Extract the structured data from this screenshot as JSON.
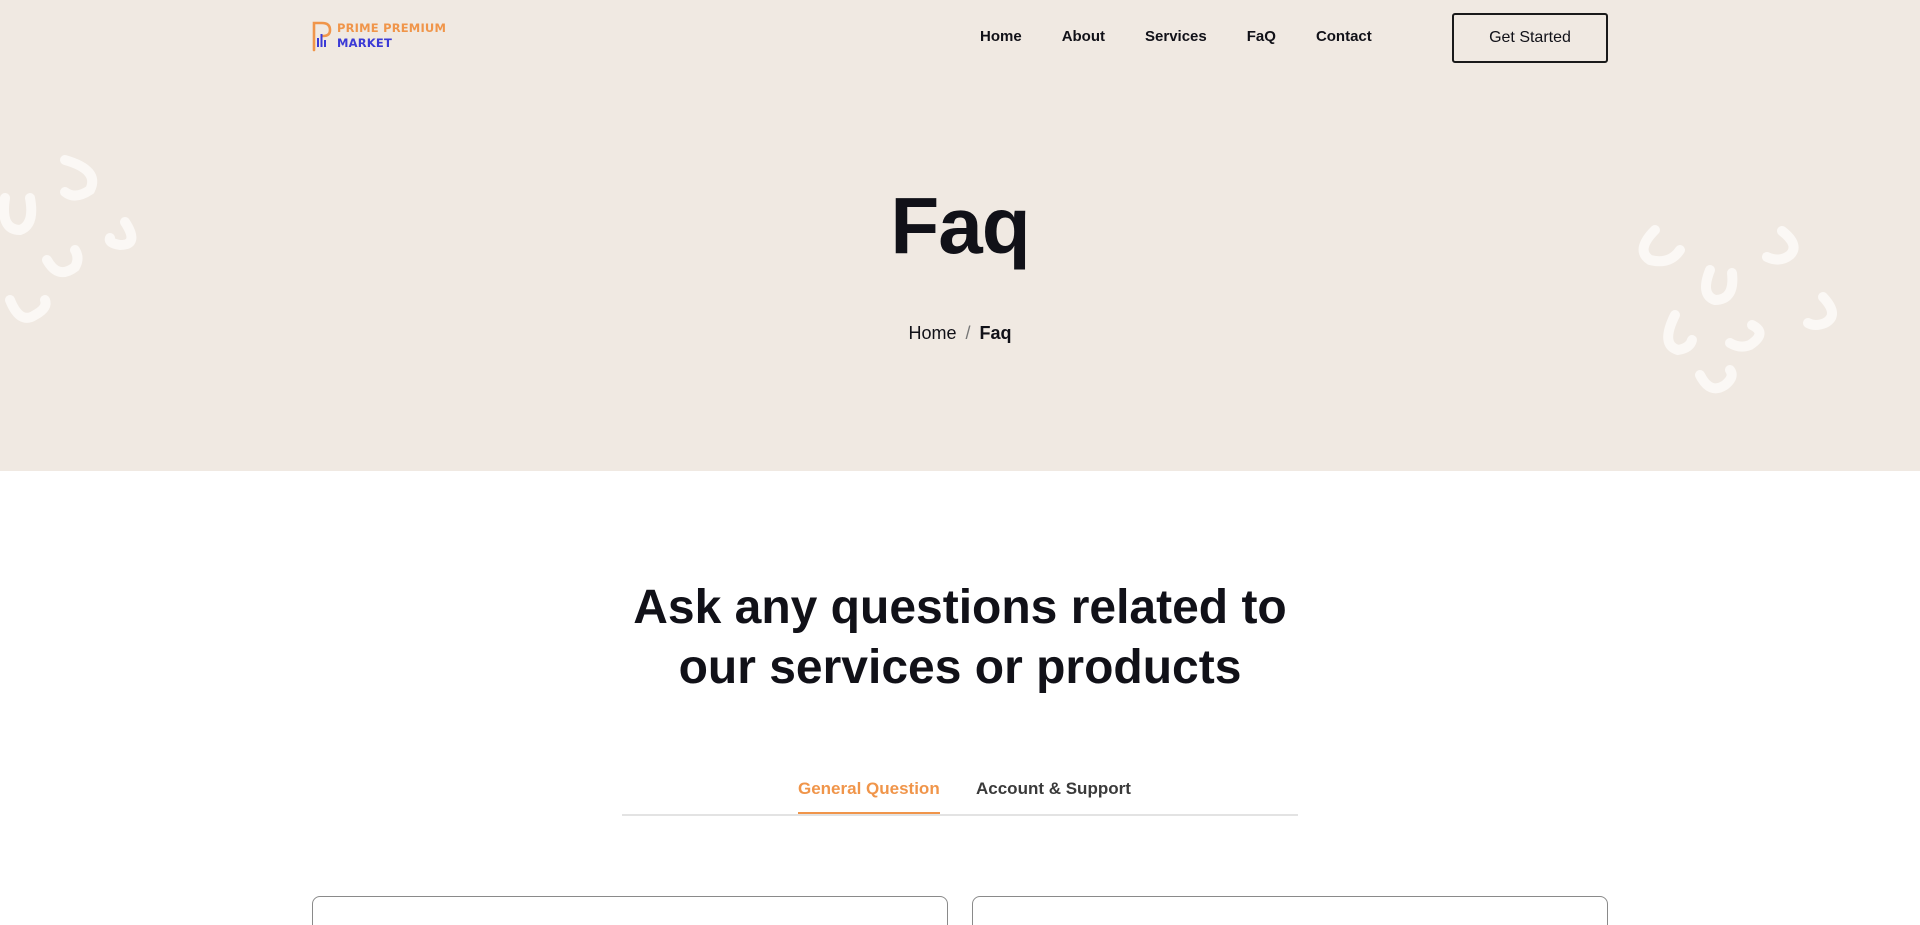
{
  "logo": {
    "line1": "PRIME PREMIUM",
    "line2": "MARKET"
  },
  "nav": {
    "items": [
      "Home",
      "About",
      "Services",
      "FaQ",
      "Contact"
    ]
  },
  "cta": {
    "label": "Get Started"
  },
  "hero": {
    "title": "Faq"
  },
  "breadcrumb": {
    "home": "Home",
    "separator": "/",
    "current": "Faq"
  },
  "section": {
    "title_line1": "Ask any questions related to",
    "title_line2": "our services or products"
  },
  "tabs": [
    {
      "label": "General Question",
      "active": true
    },
    {
      "label": "Account & Support",
      "active": false
    }
  ],
  "colors": {
    "accent": "#f0954a",
    "brand_blue": "#3b3ad6",
    "hero_bg": "#f0e9e2",
    "text": "#111118"
  }
}
